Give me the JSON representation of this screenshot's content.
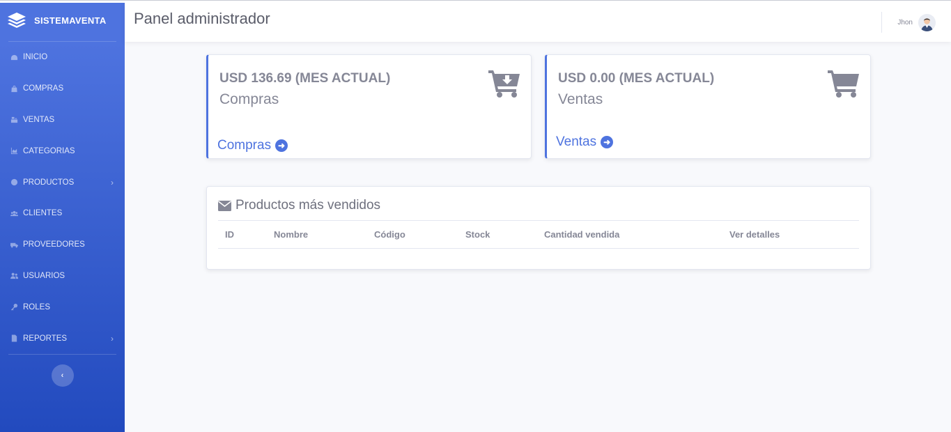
{
  "brand": {
    "name": "SISTEMAVENTA",
    "icon": "layers-icon"
  },
  "sidebar": {
    "items": [
      {
        "label": "INICIO",
        "icon": "dashboard-icon",
        "has_submenu": false
      },
      {
        "label": "COMPRAS",
        "icon": "shopping-bag-icon",
        "has_submenu": false
      },
      {
        "label": "VENTAS",
        "icon": "cash-register-icon",
        "has_submenu": false
      },
      {
        "label": "CATEGORIAS",
        "icon": "chart-area-icon",
        "has_submenu": false
      },
      {
        "label": "PRODUCTOS",
        "icon": "product-icon",
        "has_submenu": true
      },
      {
        "label": "CLIENTES",
        "icon": "users-icon",
        "has_submenu": false
      },
      {
        "label": "PROVEEDORES",
        "icon": "truck-icon",
        "has_submenu": false
      },
      {
        "label": "USUARIOS",
        "icon": "user-friends-icon",
        "has_submenu": false
      },
      {
        "label": "ROLES",
        "icon": "key-icon",
        "has_submenu": false
      },
      {
        "label": "REPORTES",
        "icon": "file-icon",
        "has_submenu": true
      }
    ],
    "toggle_icon": "chevron-left-icon"
  },
  "topbar": {
    "title": "Panel administrador",
    "user_name": "Jhon",
    "avatar_icon": "user-avatar-icon"
  },
  "cards": {
    "compras": {
      "amount": "USD 136.69 (MES ACTUAL)",
      "label": "Compras",
      "link": "Compras",
      "icon": "cart-arrow-down-icon"
    },
    "ventas": {
      "amount": "USD 0.00 (MES ACTUAL)",
      "label": "Ventas",
      "link": "Ventas",
      "icon": "shopping-cart-icon"
    }
  },
  "top_products": {
    "title": "Productos más vendidos",
    "icon": "envelope-icon",
    "columns": [
      "ID",
      "Nombre",
      "Código",
      "Stock",
      "Cantidad vendida",
      "Ver detalles"
    ],
    "rows": []
  },
  "colors": {
    "primary": "#4e73df",
    "sidebar_dark": "#224abe",
    "text_muted": "#858796",
    "background": "#f8f9fc"
  }
}
